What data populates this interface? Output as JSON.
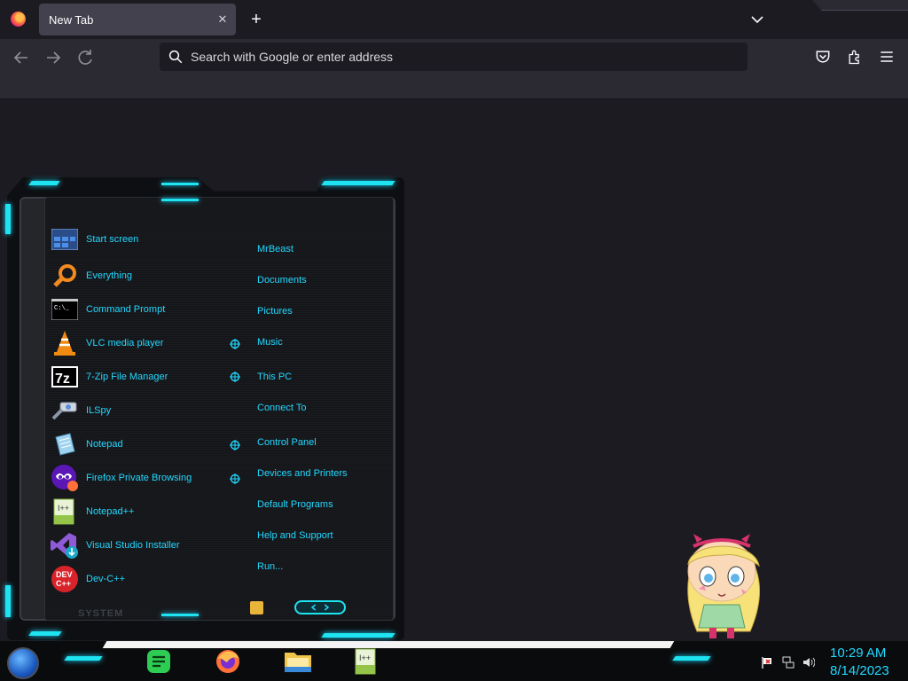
{
  "browser": {
    "tab_title": "New Tab",
    "tab_close": "✕",
    "new_tab": "+",
    "url_placeholder": "Search with Google or enter address"
  },
  "start_menu": {
    "apps": [
      {
        "label": "Start screen",
        "icon": "start-screen-icon"
      },
      {
        "label": "Everything",
        "icon": "magnifier-icon"
      },
      {
        "label": "Command Prompt",
        "icon": "cmd-icon"
      },
      {
        "label": "VLC media player",
        "icon": "vlc-cone-icon"
      },
      {
        "label": "7-Zip File Manager",
        "icon": "7zip-icon"
      },
      {
        "label": "ILSpy",
        "icon": "ilspy-icon"
      },
      {
        "label": "Notepad",
        "icon": "notepad-icon"
      },
      {
        "label": "Firefox Private Browsing",
        "icon": "firefox-private-icon"
      },
      {
        "label": "Notepad++",
        "icon": "notepadpp-icon"
      },
      {
        "label": "Visual Studio Installer",
        "icon": "vs-installer-icon"
      },
      {
        "label": "Dev-C++",
        "icon": "devcpp-icon"
      }
    ],
    "places": [
      {
        "label": "MrBeast"
      },
      {
        "label": "Documents"
      },
      {
        "label": "Pictures"
      },
      {
        "label": "Music"
      },
      {
        "label": "This PC"
      },
      {
        "label": "Connect To"
      },
      {
        "label": "Control Panel"
      },
      {
        "label": "Devices and Printers"
      },
      {
        "label": "Default Programs"
      },
      {
        "label": "Help and Support"
      },
      {
        "label": "Run..."
      }
    ],
    "system_label": "SYSTEM",
    "accent_color": "#22d8ff"
  },
  "taskbar": {
    "clock_time": "10:29 AM",
    "clock_date": "8/14/2023"
  }
}
